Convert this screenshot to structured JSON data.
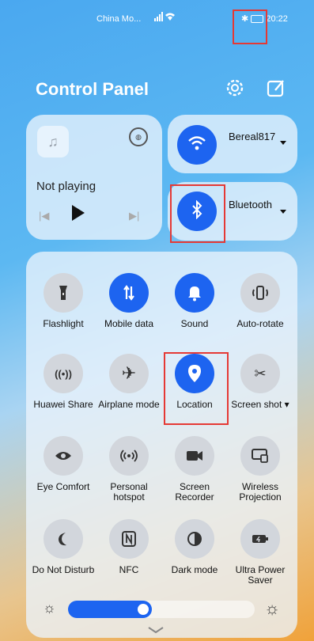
{
  "status_bar": {
    "carrier": "China Mo...",
    "signal_icons": "signal-wifi",
    "bluetooth_icon": "bluetooth-icon",
    "battery_icon": "battery-icon",
    "time": "20:22"
  },
  "header": {
    "title": "Control Panel",
    "settings_icon": "gear-icon",
    "edit_icon": "edit-icon"
  },
  "media": {
    "status": "Not playing",
    "progress": 0
  },
  "wifi": {
    "label": "Bereal817",
    "active": true
  },
  "bluetooth": {
    "label": "Bluetooth",
    "active": true
  },
  "toggles": [
    {
      "label": "Flashlight",
      "icon": "flashlight-icon",
      "active": false
    },
    {
      "label": "Mobile data",
      "icon": "mobile-data-icon",
      "active": true
    },
    {
      "label": "Sound",
      "icon": "bell-icon",
      "active": true
    },
    {
      "label": "Auto-rotate",
      "icon": "auto-rotate-icon",
      "active": false
    },
    {
      "label": "Huawei Share",
      "icon": "huawei-share-icon",
      "active": false
    },
    {
      "label": "Airplane mode",
      "icon": "airplane-icon",
      "active": false
    },
    {
      "label": "Location",
      "icon": "location-pin-icon",
      "active": true
    },
    {
      "label": "Screen shot",
      "icon": "scissors-icon",
      "active": false
    },
    {
      "label": "Eye Comfort",
      "icon": "eye-icon",
      "active": false
    },
    {
      "label": "Personal hotspot",
      "icon": "hotspot-icon",
      "active": false
    },
    {
      "label": "Screen Recorder",
      "icon": "video-camera-icon",
      "active": false
    },
    {
      "label": "Wireless Projection",
      "icon": "projection-icon",
      "active": false
    },
    {
      "label": "Do Not Disturb",
      "icon": "moon-icon",
      "active": false
    },
    {
      "label": "NFC",
      "icon": "nfc-icon",
      "active": false
    },
    {
      "label": "Dark mode",
      "icon": "dark-mode-icon",
      "active": false
    },
    {
      "label": "Ultra Power Saver",
      "icon": "battery-saver-icon",
      "active": false
    }
  ],
  "brightness": {
    "level": 0.45
  },
  "colors": {
    "accent": "#1d64f0",
    "highlight": "#e53935"
  }
}
